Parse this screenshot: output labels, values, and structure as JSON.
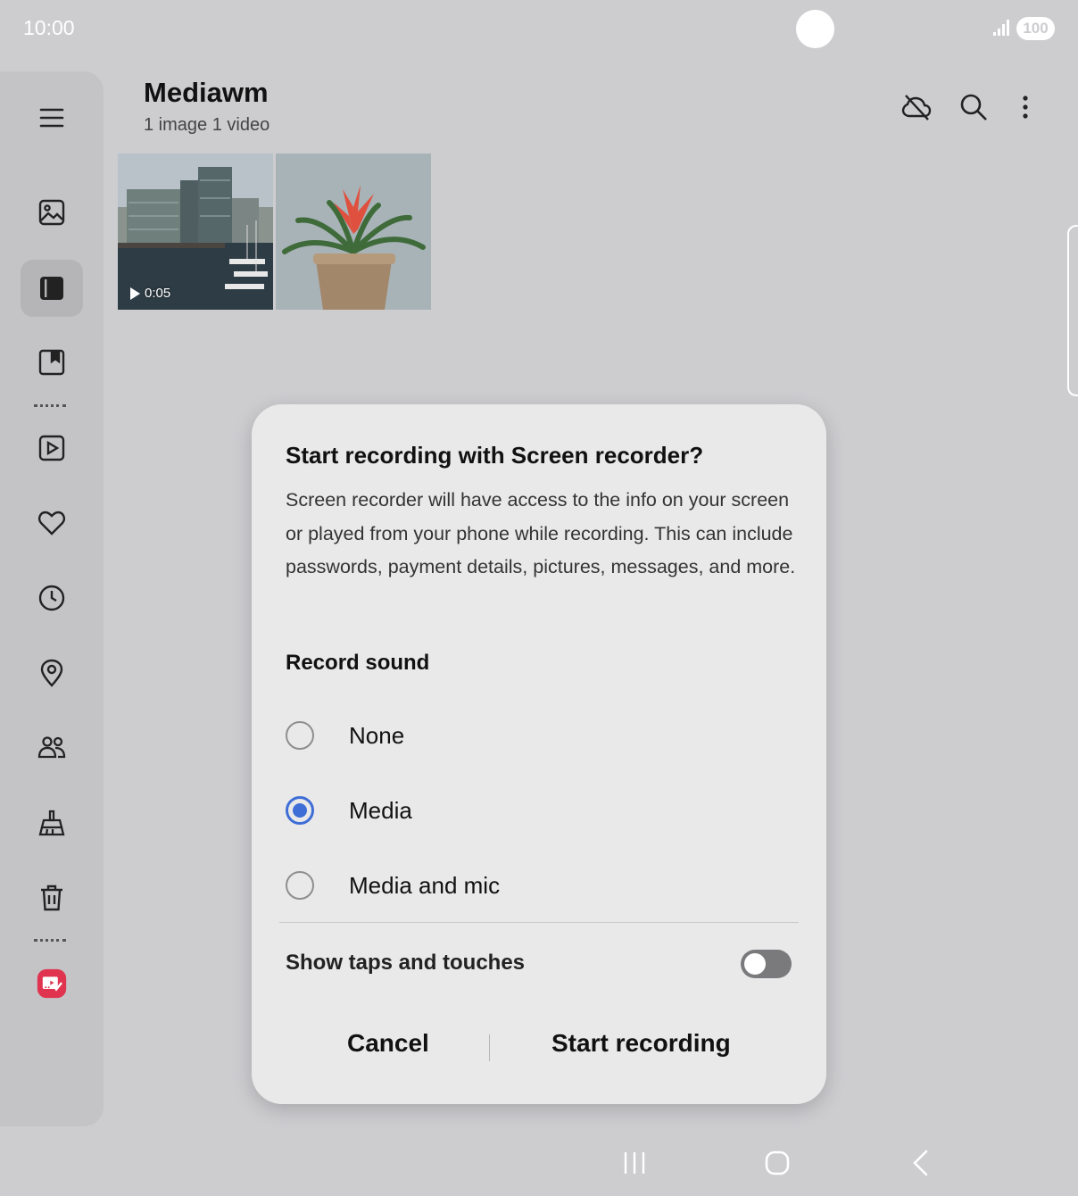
{
  "status_bar": {
    "time": "10:00",
    "battery": "100"
  },
  "rail": {
    "items": [
      {
        "name": "menu-icon"
      },
      {
        "name": "pictures-icon"
      },
      {
        "name": "albums-icon"
      },
      {
        "name": "stories-icon"
      },
      {
        "name": "videos-icon"
      },
      {
        "name": "favorites-icon"
      },
      {
        "name": "recent-icon"
      },
      {
        "name": "locations-icon"
      },
      {
        "name": "shared-icon"
      },
      {
        "name": "cleanup-icon"
      },
      {
        "name": "trash-icon"
      },
      {
        "name": "screen-recorder-icon"
      }
    ],
    "active": "albums-icon"
  },
  "header": {
    "title": "Mediawm",
    "subtitle": "1 image 1 video",
    "actions": [
      "cloud-off-icon",
      "search-icon",
      "more-options-icon"
    ]
  },
  "thumbnails": [
    {
      "kind": "video",
      "duration": "0:05"
    },
    {
      "kind": "image"
    }
  ],
  "dialog": {
    "title": "Start recording with Screen recorder?",
    "body": "Screen recorder will have access to the info on your screen or played from your phone while recording. This can include passwords, payment details, pictures, messages, and more.",
    "section_label": "Record sound",
    "options": [
      {
        "label": "None",
        "selected": false
      },
      {
        "label": "Media",
        "selected": true
      },
      {
        "label": "Media and mic",
        "selected": false
      }
    ],
    "toggle_label": "Show taps and touches",
    "toggle_on": false,
    "cancel_label": "Cancel",
    "confirm_label": "Start recording"
  },
  "colors": {
    "accent": "#3e6ed6",
    "background": "#cdcdd0",
    "dialog": "#e9e9ea",
    "recorder_icon": "#e0334f"
  },
  "nav_bar": [
    "recents-icon",
    "home-icon",
    "back-icon"
  ]
}
